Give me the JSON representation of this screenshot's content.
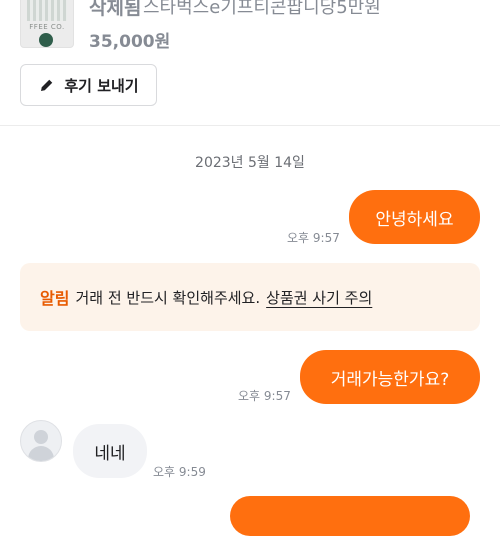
{
  "product": {
    "status": "삭제됨",
    "title": "스타벅스e기프티콘팝니당5만원",
    "price": "35,000원",
    "thumb_text": "FFEE CO."
  },
  "review_button": {
    "label": "후기 보내기",
    "icon": "pencil-icon"
  },
  "chat": {
    "date": "2023년 5월 14일",
    "messages": [
      {
        "from": "me",
        "text": "안녕하세요",
        "time": "오후 9:57"
      },
      {
        "from": "me",
        "text": "거래가능한가요?",
        "time": "오후 9:57"
      },
      {
        "from": "them",
        "text": "네네",
        "time": "오후 9:59"
      }
    ],
    "notice": {
      "tag": "알림",
      "text": "거래 전 반드시 확인해주세요.",
      "link": "상품권 사기 주의"
    }
  },
  "colors": {
    "accent": "#ff6f0f",
    "notice_bg": "#fdf3ea",
    "them_bubble": "#f2f3f6"
  }
}
